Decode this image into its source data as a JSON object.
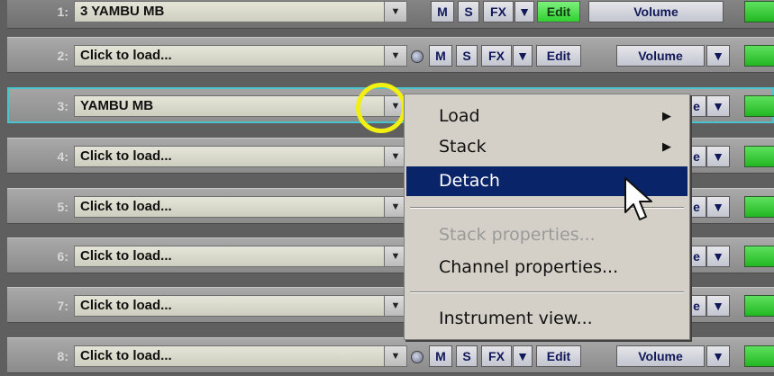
{
  "rows": [
    {
      "num": "1:",
      "label": "3  YAMBU  MB",
      "selected": false
    },
    {
      "num": "2:",
      "label": "Click to load...",
      "selected": false
    },
    {
      "num": "3:",
      "label": "YAMBU  MB",
      "selected": true
    },
    {
      "num": "4:",
      "label": "Click to load...",
      "selected": false
    },
    {
      "num": "5:",
      "label": "Click to load...",
      "selected": false
    },
    {
      "num": "6:",
      "label": "Click to load...",
      "selected": false
    },
    {
      "num": "7:",
      "label": "Click to load...",
      "selected": false
    },
    {
      "num": "8:",
      "label": "Click to load...",
      "selected": false
    }
  ],
  "buttons": {
    "mute": "M",
    "solo": "S",
    "fx": "FX",
    "edit": "Edit",
    "volume": "Volume"
  },
  "icons": {
    "dropdown": "dropdown-arrow-icon",
    "power": "power-icon",
    "submenu": "submenu-arrow-icon",
    "cursor": "mouse-cursor-icon"
  },
  "colors": {
    "selection_outline": "#48c4cc",
    "highlight_ring": "#f2ef12",
    "menu_active_bg": "#0a246a",
    "meter_green": "#22b822",
    "edit_active": "#2fd02f"
  },
  "context_menu": {
    "load": "Load",
    "stack": "Stack",
    "detach": "Detach",
    "stack_properties": "Stack properties...",
    "channel_properties": "Channel properties...",
    "instrument_view": "Instrument view..."
  }
}
